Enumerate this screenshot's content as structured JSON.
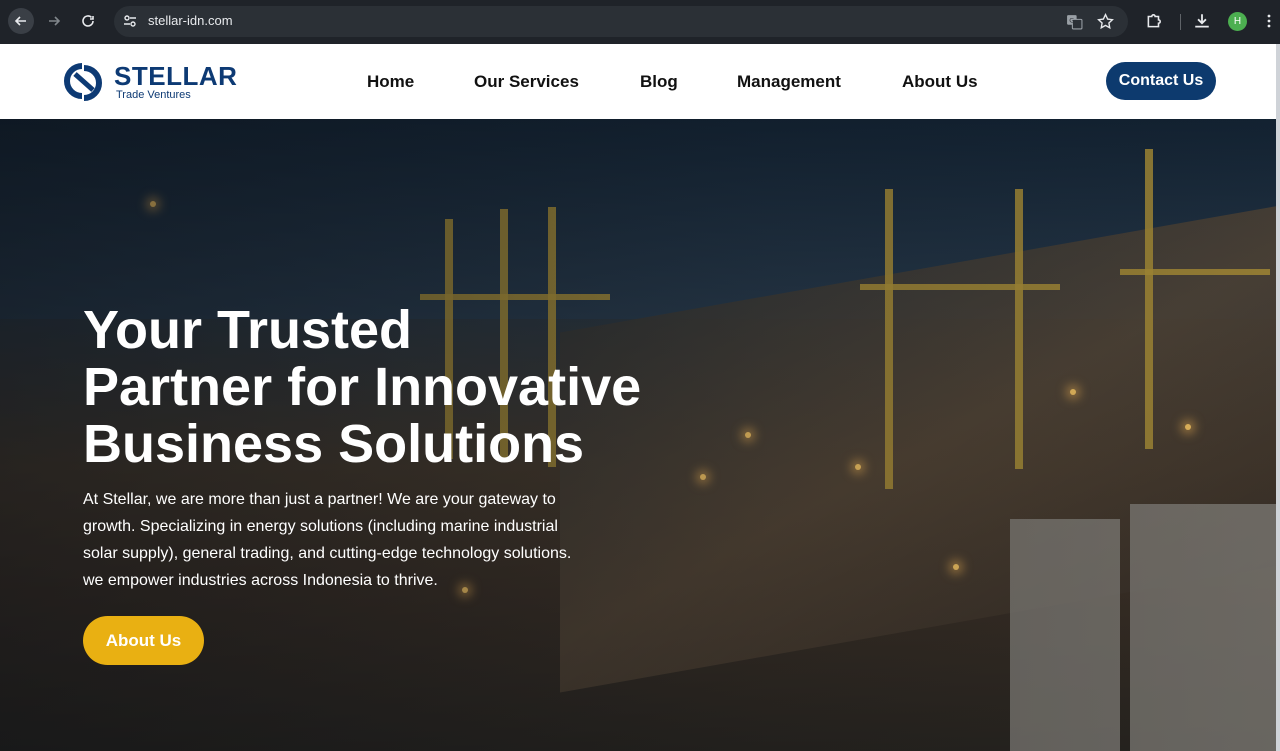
{
  "browser": {
    "url": "stellar-idn.com",
    "profile_initial": "H",
    "icons": [
      "back-arrow-icon",
      "forward-arrow-icon",
      "reload-icon",
      "site-info-icon",
      "translate-icon",
      "bookmark-star-icon",
      "extensions-icon",
      "download-icon",
      "kebab-menu-icon"
    ]
  },
  "site": {
    "logo": {
      "name": "STELLAR",
      "tagline": "Trade Ventures"
    },
    "nav": [
      "Home",
      "Our Services",
      "Blog",
      "Management",
      "About Us"
    ],
    "cta": "Contact Us"
  },
  "hero": {
    "title_lines": [
      "Your Trusted",
      "Partner for Innovative",
      "Business Solutions"
    ],
    "description_lines": [
      "At Stellar, we are more than just a partner! We are your gateway to",
      "growth. Specializing in energy solutions (including marine industrial",
      "solar supply), general trading, and cutting-edge technology solutions.",
      "we empower industries across Indonesia to thrive."
    ],
    "button": "About Us"
  },
  "colors": {
    "brand_navy": "#0d3a6e",
    "accent_yellow": "#e9b012",
    "profile_green": "#4caf50"
  }
}
